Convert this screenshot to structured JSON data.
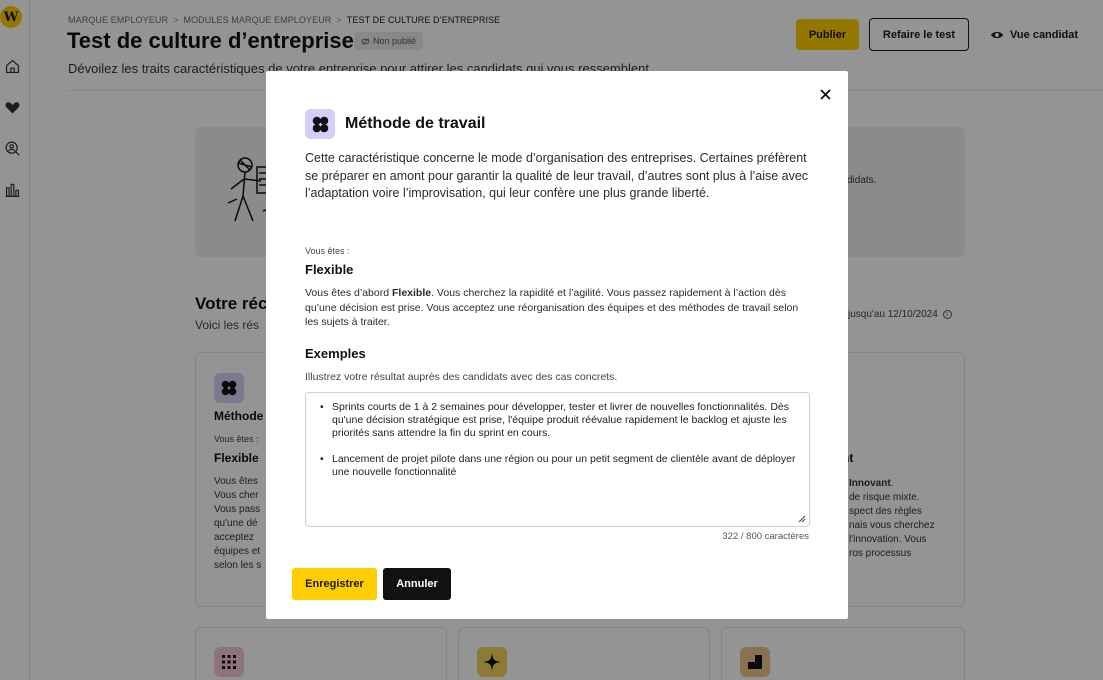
{
  "sidebar": {
    "logo_text": "W",
    "icons": [
      "home-icon",
      "heart-icon",
      "search-person-icon",
      "analytics-icon"
    ]
  },
  "header": {
    "breadcrumb": [
      "MARQUE EMPLOYEUR",
      "MODULES MARQUE EMPLOYEUR",
      "TEST DE CULTURE D’ENTREPRISE"
    ],
    "breadcrumb_sep": ">",
    "title": "Test de culture d’entreprise",
    "status_badge": "Non publié",
    "subtitle": "Dévoilez les traits caractéristiques de votre entreprise pour attirer les candidats qui vous ressemblent.",
    "publish_label": "Publier",
    "retake_label": "Refaire le test",
    "candidate_view_label": "Vue candidat"
  },
  "background": {
    "hero_text": "didats.",
    "results_title": "Votre réc",
    "results_subtitle": "Voici les rés",
    "results_date": "jusqu'au 12/10/2024",
    "card1": {
      "title": "Méthode",
      "you_are": "Vous êtes :",
      "type": "Flexible",
      "body_lines": [
        "Vous êtes",
        "Vous cher",
        "Vous pass",
        "qu'une dé",
        "acceptez",
        "équipes et",
        "selon les s"
      ]
    },
    "card3": {
      "type": "nt",
      "body_bold": "Innovant",
      "body_lines": [
        "de risque mixte.",
        "spect des règles",
        "nais vous cherchez",
        "l'innovation. Vous",
        "ros processus"
      ]
    }
  },
  "modal": {
    "title": "Méthode de travail",
    "description": "Cette caractéristique concerne le mode d’organisation des entreprises. Certaines préfèrent se préparer en amont pour garantir la qualité de leur travail, d’autres sont plus à l’aise avec l’adaptation voire l’improvisation, qui leur confère une plus grande liberté.",
    "you_are_label": "Vous êtes :",
    "result_type": "Flexible",
    "result_desc_prefix": "Vous êtes d’abord ",
    "result_desc_bold": "Flexible",
    "result_desc_rest": ". Vous cherchez la rapidité et l’agilité. Vous passez rapidement à l’action dès qu’une décision est prise. Vous acceptez une réorganisation des équipes et des méthodes de travail selon les sujets à traiter.",
    "examples_title": "Exemples",
    "examples_hint": "Illustrez votre résultat auprès des candidats avec des cas concrets.",
    "examples": [
      "Sprints courts de 1 à 2 semaines pour développer, tester et livrer de nouvelles fonctionnalités. Dès qu'une décision stratégique est prise, l'équipe produit réévalue rapidement le backlog et ajuste les priorités sans attendre la fin du sprint en cours.",
      "Lancement de projet pilote dans une région ou pour un petit segment de clientèle avant de déployer une nouvelle fonctionnalité"
    ],
    "char_count": "322 / 800  caractères",
    "save_label": "Enregistrer",
    "cancel_label": "Annuler"
  },
  "colors": {
    "accent_yellow": "#ffcd00",
    "modal_icon_purple": "#d7cdf9",
    "card_icon_pink": "#f2c6d8",
    "card_icon_yellow": "#f3d35c",
    "card_icon_orange": "#f2c38a"
  }
}
